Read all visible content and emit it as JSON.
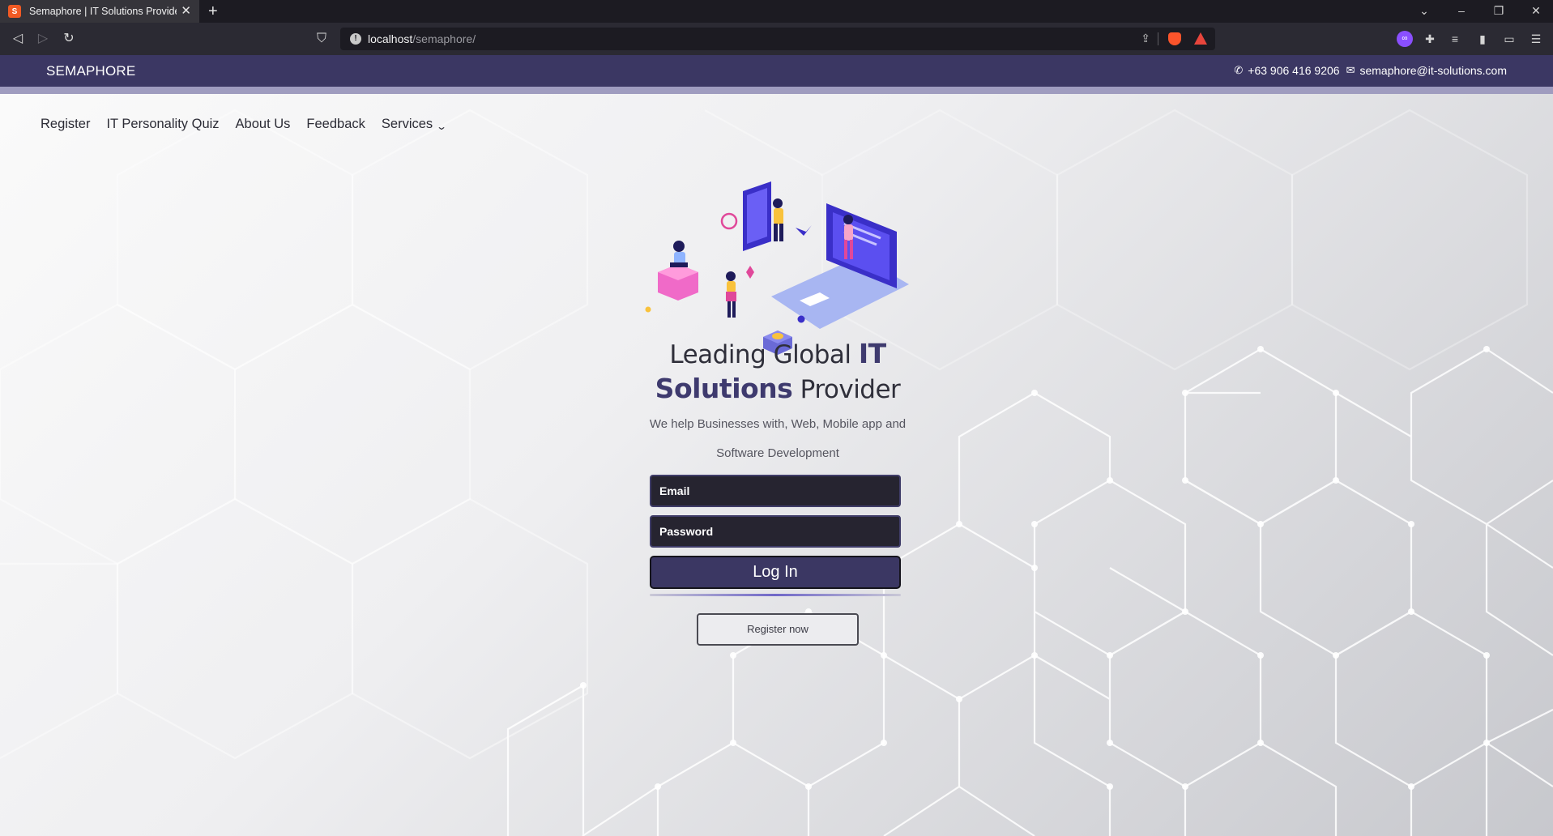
{
  "browser": {
    "tab_title": "Semaphore | IT Solutions Provider",
    "tab_favicon_text": "S",
    "url_host": "localhost",
    "url_path": "/semaphore/"
  },
  "site": {
    "brand": "SEMAPHORE",
    "phone": "+63 906 416 9206",
    "email": "semaphore@it-solutions.com",
    "nav": {
      "register": "Register",
      "quiz": "IT Personality Quiz",
      "about": "About Us",
      "feedback": "Feedback",
      "services": "Services"
    }
  },
  "hero": {
    "headline_pre": "Leading Global ",
    "headline_hl1": "IT",
    "headline_hl2": "Solutions",
    "headline_post": " Provider",
    "subline": "We help Businesses with, Web, Mobile app and Software Development"
  },
  "form": {
    "email_placeholder": "Email",
    "password_placeholder": "Password",
    "login_label": "Log In",
    "register_label": "Register now"
  },
  "colors": {
    "brand_purple": "#3b3763",
    "accent_stripe": "#9f9cbf",
    "field_bg": "#262430"
  },
  "icons": {
    "phone": "phone-icon",
    "email": "envelope-icon",
    "services_dropdown": "chevron-down-icon"
  }
}
